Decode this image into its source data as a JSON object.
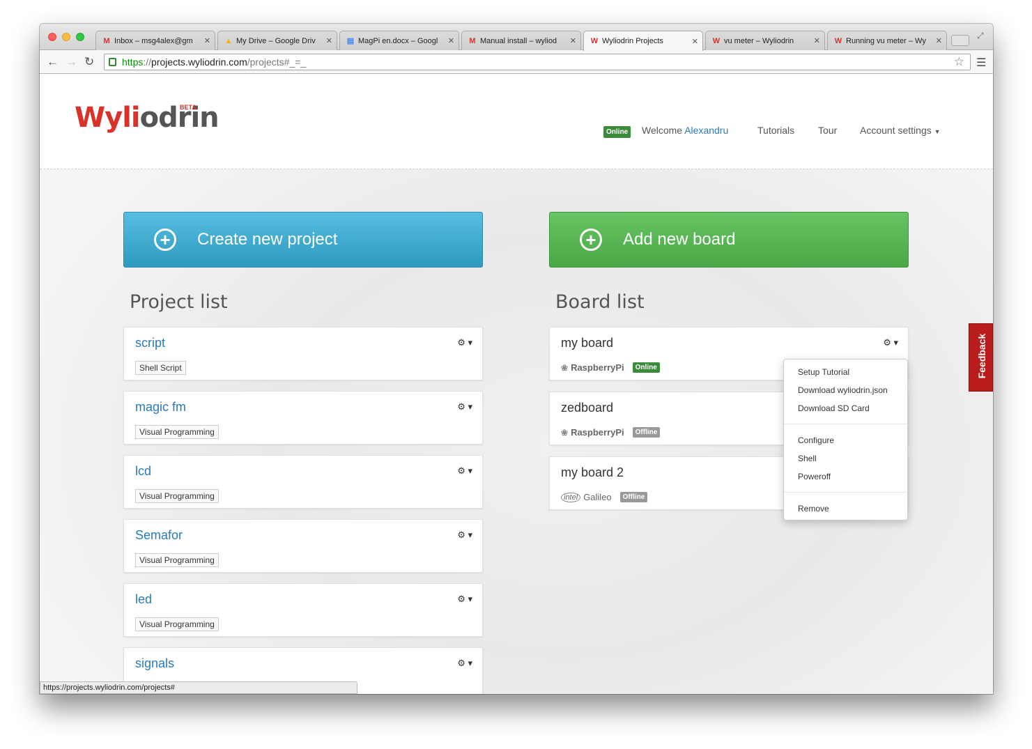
{
  "browser": {
    "tabs": [
      {
        "icon": "gmail-icon",
        "title": "Inbox – msg4alex@gm"
      },
      {
        "icon": "drive-icon",
        "title": "My Drive – Google Driv"
      },
      {
        "icon": "docs-icon",
        "title": "MagPi en.docx – Googl"
      },
      {
        "icon": "gmail-icon",
        "title": "Manual install – wyliod"
      },
      {
        "icon": "wyliodrin-icon",
        "title": "Wyliodrin Projects"
      },
      {
        "icon": "wyliodrin-icon",
        "title": "vu meter – Wyliodrin"
      },
      {
        "icon": "wyliodrin-icon",
        "title": "Running vu meter – Wy"
      }
    ],
    "url": {
      "scheme": "https",
      "sep": "://",
      "host": "projects.wyliodrin.com",
      "path": "/projects#_=_"
    },
    "status_url": "https://projects.wyliodrin.com/projects#"
  },
  "header": {
    "logo": "Wyliodrin",
    "logo_part1": "Wyli",
    "logo_part2": "odrin",
    "beta": "BETA",
    "status": "Online",
    "welcome": "Welcome",
    "username": "Alexandru",
    "nav": [
      "Tutorials",
      "Tour",
      "Account settings"
    ]
  },
  "actions": {
    "create_project": "Create new project",
    "add_board": "Add new board"
  },
  "projects": {
    "title": "Project list",
    "items": [
      {
        "name": "script",
        "type": "Shell Script"
      },
      {
        "name": "magic fm",
        "type": "Visual Programming"
      },
      {
        "name": "lcd",
        "type": "Visual Programming"
      },
      {
        "name": "Semafor",
        "type": "Visual Programming"
      },
      {
        "name": "led",
        "type": "Visual Programming"
      },
      {
        "name": "signals",
        "type": ""
      }
    ]
  },
  "boards": {
    "title": "Board list",
    "items": [
      {
        "name": "my board",
        "platform": "RaspberryPi",
        "status": "Online"
      },
      {
        "name": "zedboard",
        "platform": "RaspberryPi",
        "status": "Offline"
      },
      {
        "name": "my board 2",
        "platform": "Galileo",
        "vendor": "intel",
        "status": "Offline"
      }
    ]
  },
  "board_menu": {
    "group1": [
      "Setup Tutorial",
      "Download wyliodrin.json",
      "Download SD Card"
    ],
    "group2": [
      "Configure",
      "Shell",
      "Poweroff"
    ],
    "group3": [
      "Remove"
    ]
  },
  "feedback": "Feedback",
  "colors": {
    "brand_red": "#d9322a",
    "link_blue": "#2a7ab8",
    "online_green": "#3c8a3c",
    "create_blue": "#2e9ac0",
    "add_green": "#4aa847"
  }
}
